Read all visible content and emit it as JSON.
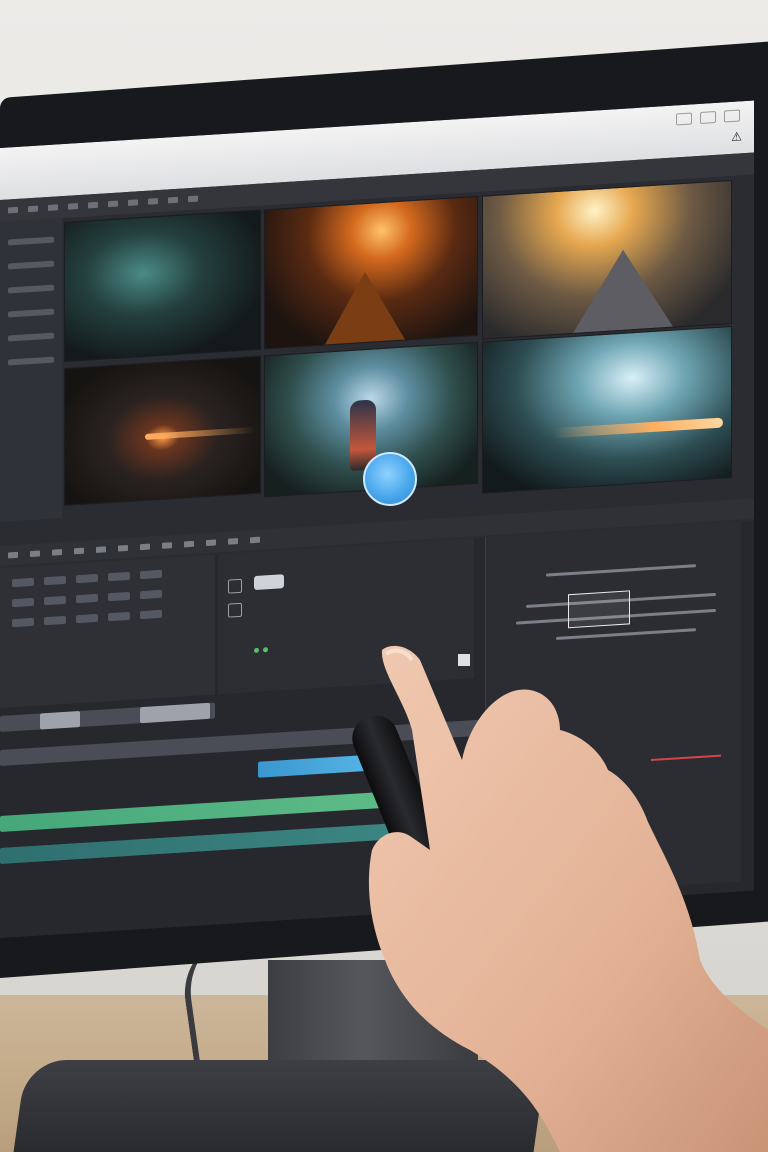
{
  "scene": {
    "description_kind": "photo of a person touching a video editing app on a monitor"
  },
  "editor": {
    "right_panel_title": "",
    "clip_tags": [
      "",
      "",
      "",
      "",
      "",
      ""
    ]
  },
  "colors": {
    "accent_blue": "#4aa8ec",
    "track_green": "#63c08a",
    "track_blue": "#58b6e6",
    "highlight_red": "#d8434a"
  },
  "icons": [
    "warning-icon",
    "play-circle-icon",
    "window-control-icon"
  ]
}
